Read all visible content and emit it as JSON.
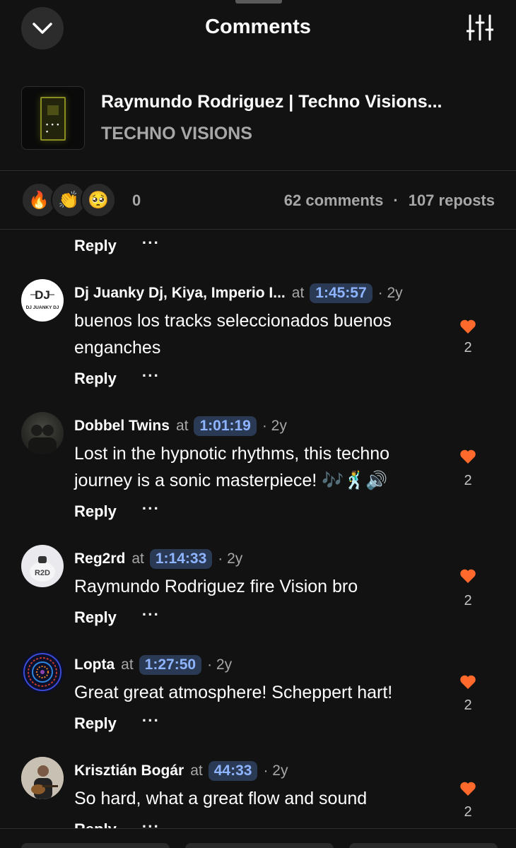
{
  "header": {
    "title": "Comments",
    "collapse_icon": "chevron-down-icon",
    "filter_icon": "sliders-icon"
  },
  "track": {
    "title": "Raymundo Rodriguez | Techno Visions...",
    "artist": "TECHNO VISIONS"
  },
  "stats": {
    "reactions": [
      "🔥",
      "👏",
      "🥺"
    ],
    "reaction_count": "0",
    "comments": "62 comments",
    "separator": "·",
    "reposts": "107 reposts"
  },
  "reply_label": "Reply",
  "more_label": "···",
  "at_label": "at",
  "comments": [
    {
      "author": "Dj Juanky Dj, Kiya, Imperio I...",
      "timestamp": "1:45:57",
      "age": "· 2y",
      "text": "buenos los tracks seleccionados buenos enganches",
      "likes": "2",
      "avatar": "dj-juanky-logo",
      "avatar_text": "DJ JUANKY DJ"
    },
    {
      "author": "Dobbel Twins",
      "timestamp": "1:01:19",
      "age": "· 2y",
      "text": "Lost in the hypnotic rhythms, this techno journey is a sonic masterpiece! 🎶🕺🔊",
      "likes": "2",
      "avatar": "dobbel-twins-photo"
    },
    {
      "author": "Reg2rd",
      "timestamp": "1:14:33",
      "age": "· 2y",
      "text": "Raymundo Rodriguez fire Vision bro",
      "likes": "2",
      "avatar": "reg2rd-logo",
      "avatar_text": "R2D"
    },
    {
      "author": "Lopta",
      "timestamp": "1:27:50",
      "age": "· 2y",
      "text": "Great great atmosphere! Scheppert hart!",
      "likes": "2",
      "avatar": "lopta-mandala"
    },
    {
      "author": "Krisztián Bogár",
      "timestamp": "44:33",
      "age": "· 2y",
      "text": "So hard, what a great flow and sound",
      "likes": "2",
      "avatar": "krisztian-guitar-photo"
    }
  ],
  "colors": {
    "background": "#121212",
    "timestamp_bg": "#2a3a55",
    "timestamp_text": "#8fb4ff",
    "like": "#ff6a2c",
    "muted": "#a7a7a7"
  }
}
